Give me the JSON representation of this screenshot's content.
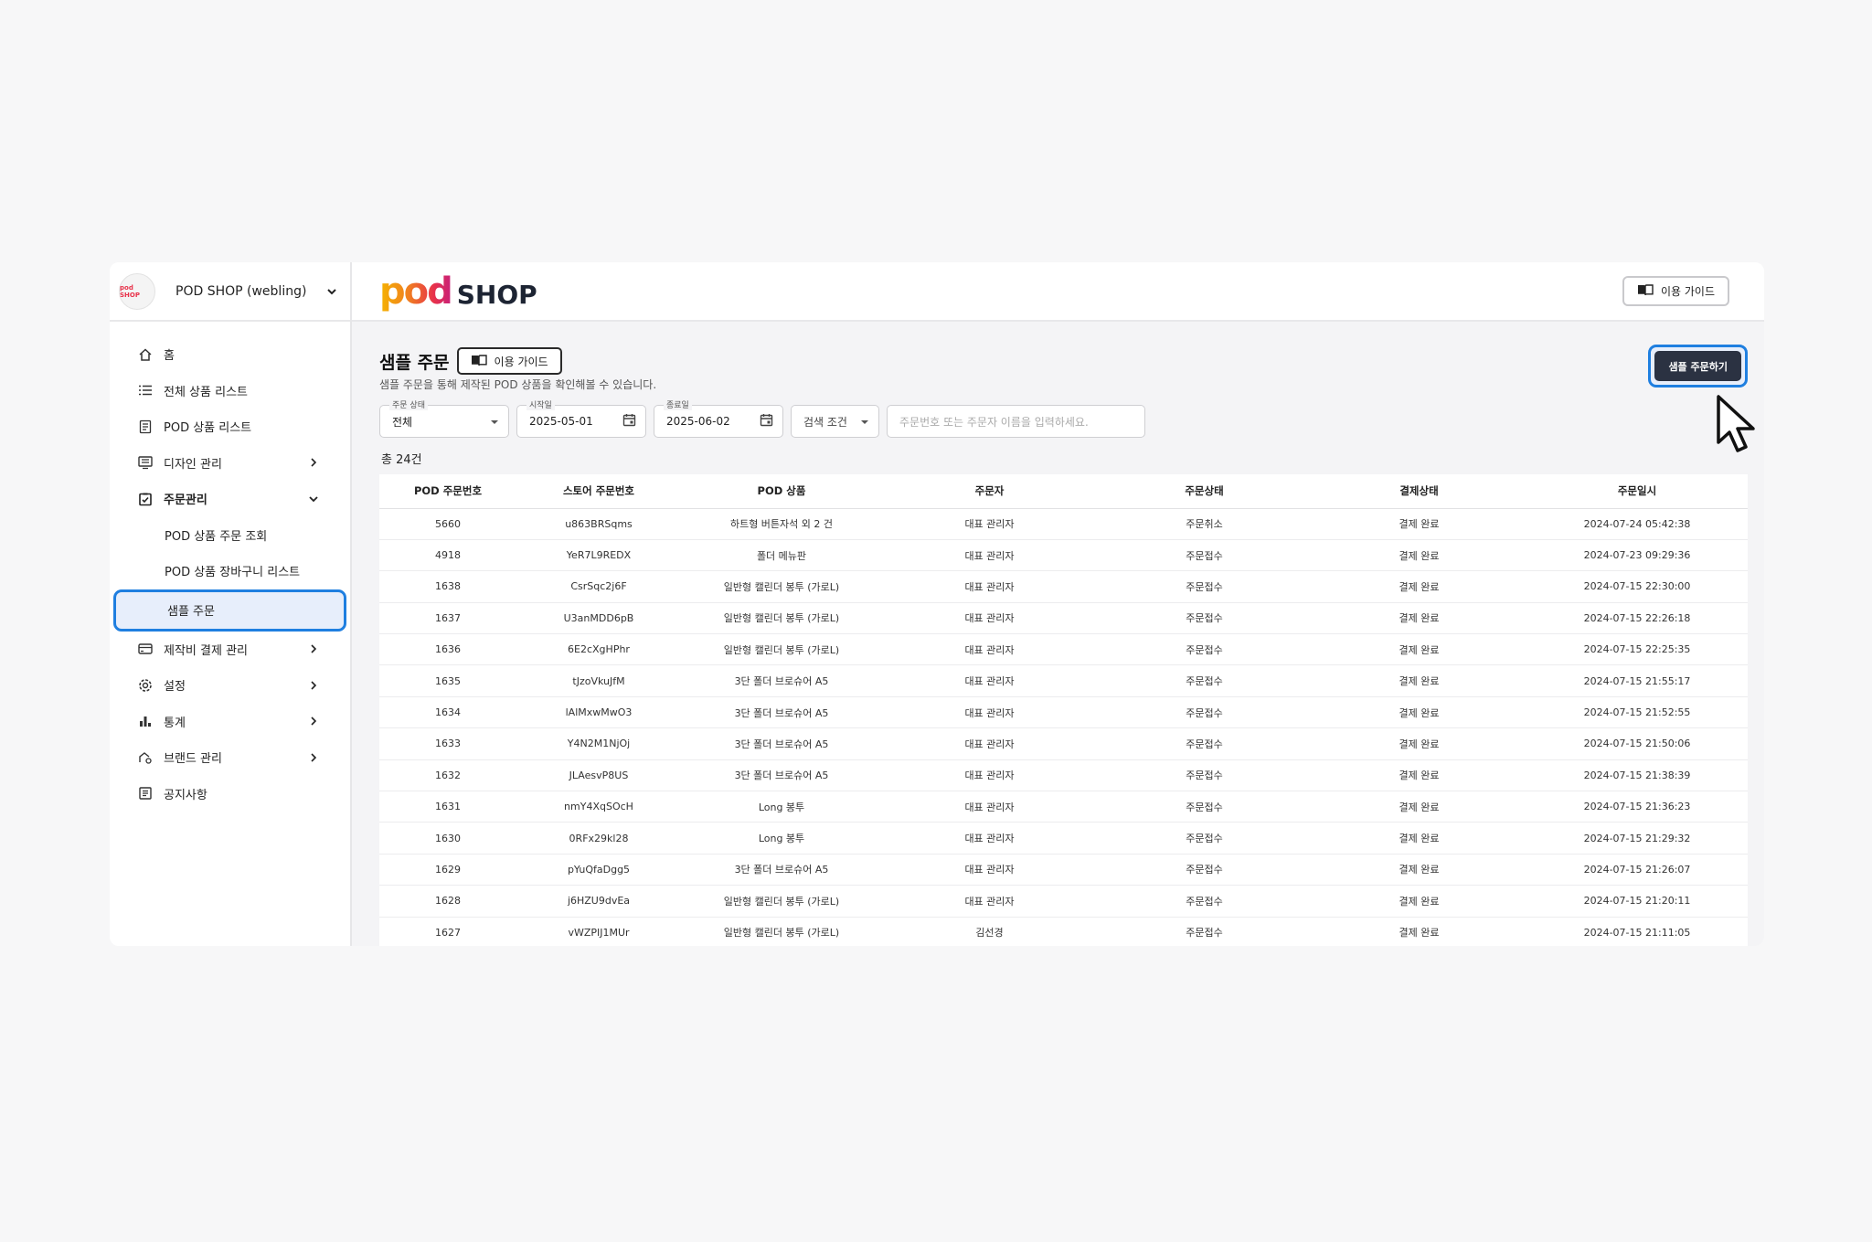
{
  "sidebar": {
    "shop_name": "POD SHOP (webling)",
    "logo_text": "pod SHOP",
    "items": [
      {
        "label": "홈",
        "icon": "home-icon",
        "chevron": "",
        "bold": false
      },
      {
        "label": "전체 상품 리스트",
        "icon": "list-icon",
        "chevron": "",
        "bold": false
      },
      {
        "label": "POD 상품 리스트",
        "icon": "document-icon",
        "chevron": "",
        "bold": false
      },
      {
        "label": "디자인 관리",
        "icon": "monitor-icon",
        "chevron": "right",
        "bold": false
      },
      {
        "label": "주문관리",
        "icon": "clipboard-check-icon",
        "chevron": "down",
        "bold": true
      }
    ],
    "sub_items": [
      {
        "label": "POD 상품 주문 조회",
        "selected": false
      },
      {
        "label": "POD 상품 장바구니 리스트",
        "selected": false
      },
      {
        "label": "샘플 주문",
        "selected": true
      }
    ],
    "items_after": [
      {
        "label": "제작비 결제 관리",
        "icon": "card-icon",
        "chevron": "right"
      },
      {
        "label": "설정",
        "icon": "gear-icon",
        "chevron": "right"
      },
      {
        "label": "통계",
        "icon": "bar-chart-icon",
        "chevron": "right"
      },
      {
        "label": "브랜드 관리",
        "icon": "brand-icon",
        "chevron": "right"
      },
      {
        "label": "공지사항",
        "icon": "notice-icon",
        "chevron": ""
      }
    ]
  },
  "header": {
    "brand_pod": "pod",
    "brand_shop": "SHOP",
    "guide_label": "이용 가이드"
  },
  "page": {
    "title": "샘플 주문",
    "guide_label": "이용 가이드",
    "description": "샘플 주문을 통해 제작된 POD 상품을 확인해볼 수 있습니다.",
    "order_button": "샘플 주문하기"
  },
  "filters": {
    "status_label": "주문 상태",
    "status_value": "전체",
    "start_label": "시작일",
    "start_value": "2025-05-01",
    "end_label": "종료일",
    "end_value": "2025-06-02",
    "search_condition": "검색 조건",
    "search_placeholder": "주문번호 또는 주문자 이름을 입력하세요."
  },
  "total_text": "총 24건",
  "table": {
    "columns": [
      "POD 주문번호",
      "스토어 주문번호",
      "POD 상품",
      "주문자",
      "주문상태",
      "결제상태",
      "주문일시"
    ],
    "rows": [
      [
        "5660",
        "u863BRSqms",
        "하트형 버튼자석 외 2 건",
        "대표 관리자",
        "주문취소",
        "결제 완료",
        "2024-07-24 05:42:38"
      ],
      [
        "4918",
        "YeR7L9REDX",
        "폴더 메뉴판",
        "대표 관리자",
        "주문접수",
        "결제 완료",
        "2024-07-23 09:29:36"
      ],
      [
        "1638",
        "CsrSqc2j6F",
        "일반형 캘린더 봉투 (가로L)",
        "대표 관리자",
        "주문접수",
        "결제 완료",
        "2024-07-15 22:30:00"
      ],
      [
        "1637",
        "U3anMDD6pB",
        "일반형 캘린더 봉투 (가로L)",
        "대표 관리자",
        "주문접수",
        "결제 완료",
        "2024-07-15 22:26:18"
      ],
      [
        "1636",
        "6E2cXgHPhr",
        "일반형 캘린더 봉투 (가로L)",
        "대표 관리자",
        "주문접수",
        "결제 완료",
        "2024-07-15 22:25:35"
      ],
      [
        "1635",
        "tJzoVkuJfM",
        "3단 폴더 브로슈어 A5",
        "대표 관리자",
        "주문접수",
        "결제 완료",
        "2024-07-15 21:55:17"
      ],
      [
        "1634",
        "lAlMxwMwO3",
        "3단 폴더 브로슈어 A5",
        "대표 관리자",
        "주문접수",
        "결제 완료",
        "2024-07-15 21:52:55"
      ],
      [
        "1633",
        "Y4N2M1NjOj",
        "3단 폴더 브로슈어 A5",
        "대표 관리자",
        "주문접수",
        "결제 완료",
        "2024-07-15 21:50:06"
      ],
      [
        "1632",
        "JLAesvP8US",
        "3단 폴더 브로슈어 A5",
        "대표 관리자",
        "주문접수",
        "결제 완료",
        "2024-07-15 21:38:39"
      ],
      [
        "1631",
        "nmY4XqSOcH",
        "Long 봉투",
        "대표 관리자",
        "주문접수",
        "결제 완료",
        "2024-07-15 21:36:23"
      ],
      [
        "1630",
        "0RFx29kl28",
        "Long 봉투",
        "대표 관리자",
        "주문접수",
        "결제 완료",
        "2024-07-15 21:29:32"
      ],
      [
        "1629",
        "pYuQfaDgg5",
        "3단 폴더 브로슈어 A5",
        "대표 관리자",
        "주문접수",
        "결제 완료",
        "2024-07-15 21:26:07"
      ],
      [
        "1628",
        "j6HZU9dvEa",
        "일반형 캘린더 봉투 (가로L)",
        "대표 관리자",
        "주문접수",
        "결제 완료",
        "2024-07-15 21:20:11"
      ],
      [
        "1627",
        "vWZPIJ1MUr",
        "일반형 캘린더 봉투 (가로L)",
        "김선경",
        "주문접수",
        "결제 완료",
        "2024-07-15 21:11:05"
      ]
    ]
  },
  "colors": {
    "accent_blue": "#1f7fe0",
    "button_dark": "#2b3242",
    "selected_bg": "#e7eefb"
  }
}
